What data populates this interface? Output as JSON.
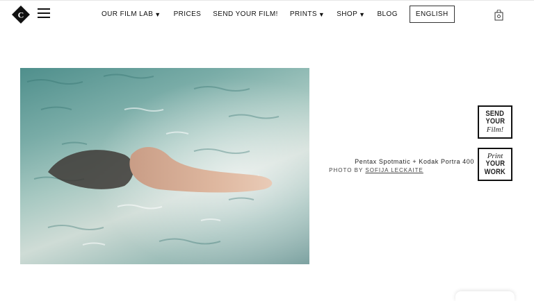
{
  "logo": {
    "letter": "C"
  },
  "nav": {
    "items": [
      {
        "label": "OUR FILM LAB",
        "caret": "▼"
      },
      {
        "label": "PRICES"
      },
      {
        "label": "SEND YOUR FILM!"
      },
      {
        "label": "PRINTS",
        "caret": "▼"
      },
      {
        "label": "SHOP",
        "caret": "▼"
      },
      {
        "label": "BLOG"
      }
    ],
    "language": "ENGLISH"
  },
  "photo": {
    "camera_info": "Pentax Spotmatic + Kodak Portra 400",
    "credit_prefix": "PHOTO BY",
    "credit_name": "SOFIJA LECKAITE"
  },
  "badges": {
    "send": {
      "line1": "SEND",
      "line2": "YOUR",
      "line3": "Film!"
    },
    "print": {
      "line1": "Print",
      "line2": "YOUR",
      "line3": "WORK"
    }
  },
  "colors": {
    "text": "#111111",
    "background": "#ffffff",
    "water": "#79aca7"
  },
  "icons": {
    "menu": "hamburger-icon",
    "cart": "shopping-bag-icon"
  }
}
